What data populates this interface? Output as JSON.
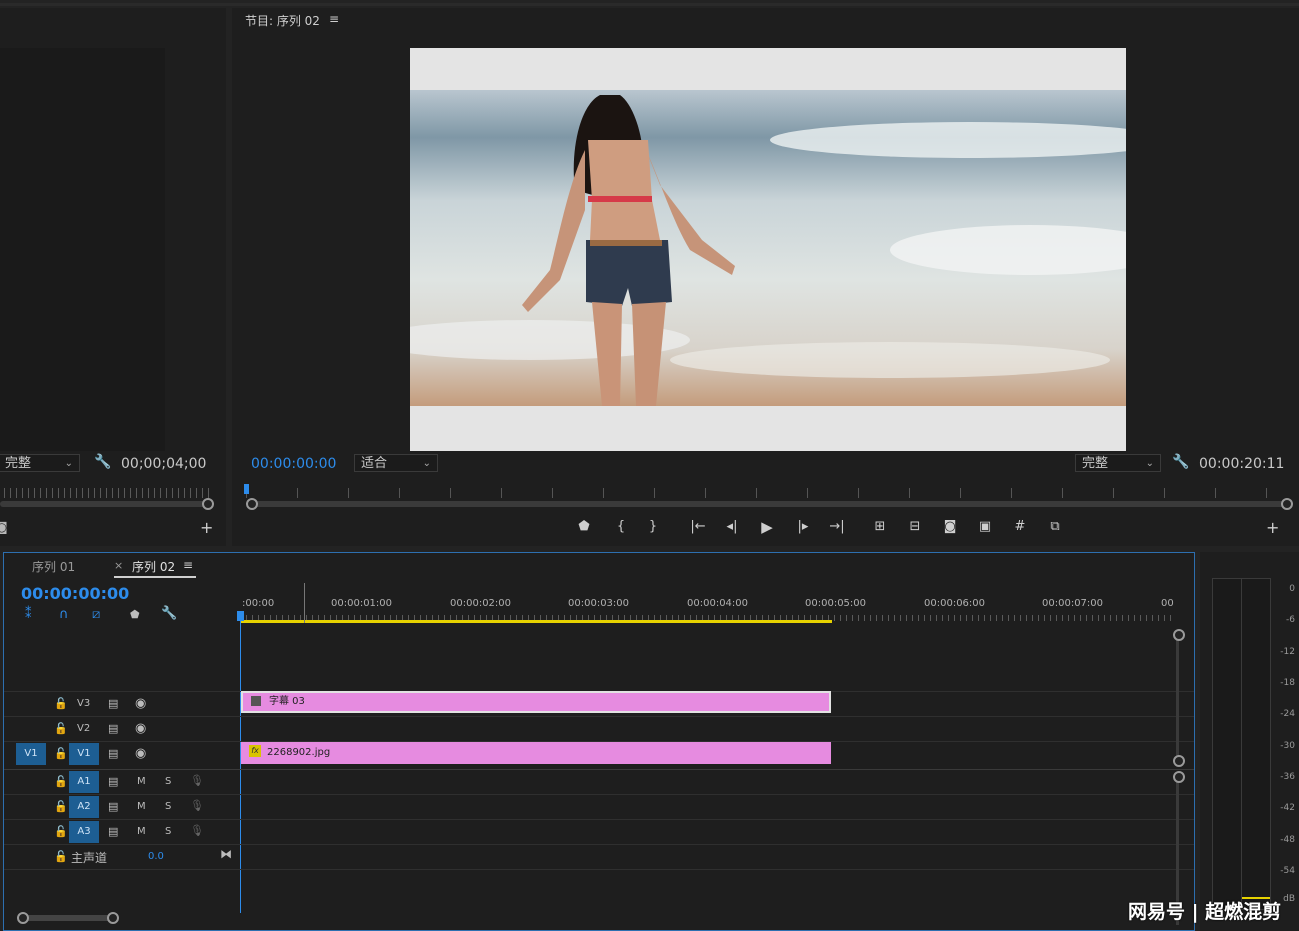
{
  "source_monitor": {
    "quality": "完整",
    "timecode": "00;00;04;00"
  },
  "program_monitor": {
    "title": "节目: 序列 02",
    "timecode_left": "00:00:00:00",
    "fit": "适合",
    "quality": "完整",
    "timecode_right": "00:00:20:11"
  },
  "timeline": {
    "tabs": [
      {
        "label": "序列 01"
      },
      {
        "label": "序列 02"
      }
    ],
    "close_glyph": "×",
    "timecode": "00:00:00:00",
    "ruler_labels": [
      ":00:00",
      "00:00:01:00",
      "00:00:02:00",
      "00:00:03:00",
      "00:00:04:00",
      "00:00:05:00",
      "00:00:06:00",
      "00:00:07:00",
      "00"
    ],
    "video_tracks": [
      {
        "name": "V3",
        "source": ""
      },
      {
        "name": "V2",
        "source": ""
      },
      {
        "name": "V1",
        "source": "V1"
      }
    ],
    "audio_tracks": [
      {
        "name": "A1",
        "m": "M",
        "s": "S"
      },
      {
        "name": "A2",
        "m": "M",
        "s": "S"
      },
      {
        "name": "A3",
        "m": "M",
        "s": "S"
      }
    ],
    "master": {
      "label": "主声道",
      "value": "0.0"
    },
    "clips": [
      {
        "name": "字幕 03",
        "badge": "",
        "color": "#e68be0"
      },
      {
        "name": "2268902.jpg",
        "badge": "fx",
        "color": "#e68be0"
      }
    ]
  },
  "audio_meter": {
    "scale": [
      "0",
      "-6",
      "-12",
      "-18",
      "-24",
      "-30",
      "-36",
      "-42",
      "-48",
      "-54",
      "dB"
    ]
  },
  "watermark": "网易号 | 超燃混剪",
  "colors": {
    "accent": "#2d8ceb",
    "clip": "#e68be0",
    "track_badge": "#1d5e93",
    "work_area": "#e6d200"
  }
}
